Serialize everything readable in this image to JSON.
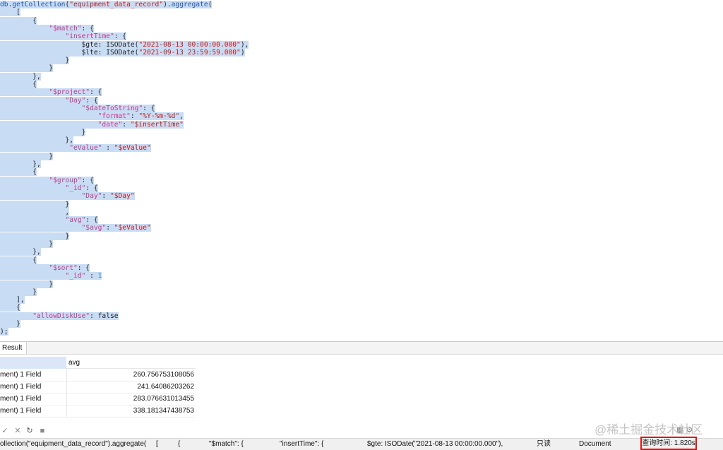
{
  "editor": {
    "lines": [
      [
        [
          "f",
          "db"
        ],
        [
          "p",
          "."
        ],
        [
          "f",
          "getCollection"
        ],
        [
          "p",
          "("
        ],
        [
          "s",
          "\"equipment_data_record\""
        ],
        [
          "p",
          ")."
        ],
        [
          "f",
          "aggregate"
        ],
        [
          "p",
          "("
        ]
      ],
      [
        [
          "p",
          "    ["
        ]
      ],
      [
        [
          "p",
          "        {"
        ]
      ],
      [
        [
          "p",
          "            "
        ],
        [
          "k",
          "\"$match\""
        ],
        [
          "p",
          ": {"
        ]
      ],
      [
        [
          "p",
          "                "
        ],
        [
          "k",
          "\"insertTime\""
        ],
        [
          "p",
          ": {"
        ]
      ],
      [
        [
          "p",
          "                    "
        ],
        [
          "i",
          "$gte"
        ],
        [
          "p",
          ": "
        ],
        [
          "i",
          "ISODate"
        ],
        [
          "p",
          "("
        ],
        [
          "s",
          "\"2021-08-13 00:00:00.000\""
        ],
        [
          "p",
          "),"
        ]
      ],
      [
        [
          "p",
          "                    "
        ],
        [
          "i",
          "$lte"
        ],
        [
          "p",
          ": "
        ],
        [
          "i",
          "ISODate"
        ],
        [
          "p",
          "("
        ],
        [
          "s",
          "\"2021-09-13 23:59:59.000\""
        ],
        [
          "p",
          ")"
        ]
      ],
      [
        [
          "p",
          "                }"
        ]
      ],
      [
        [
          "p",
          "            }"
        ]
      ],
      [
        [
          "p",
          "        },"
        ]
      ],
      [
        [
          "p",
          "        {"
        ]
      ],
      [
        [
          "p",
          "            "
        ],
        [
          "k",
          "\"$project\""
        ],
        [
          "p",
          ": {"
        ]
      ],
      [
        [
          "p",
          "                "
        ],
        [
          "k",
          "\"Day\""
        ],
        [
          "p",
          ": {"
        ]
      ],
      [
        [
          "p",
          "                    "
        ],
        [
          "k",
          "\"$dateToString\""
        ],
        [
          "p",
          ": {"
        ]
      ],
      [
        [
          "p",
          "                        "
        ],
        [
          "k",
          "\"format\""
        ],
        [
          "p",
          ": "
        ],
        [
          "s",
          "\"%Y-%m-%d\""
        ],
        [
          "p",
          ","
        ]
      ],
      [
        [
          "p",
          "                        "
        ],
        [
          "k",
          "\"date\""
        ],
        [
          "p",
          ": "
        ],
        [
          "s",
          "\"$insertTime\""
        ]
      ],
      [
        [
          "p",
          "                    }"
        ]
      ],
      [
        [
          "p",
          "                },"
        ]
      ],
      [
        [
          "p",
          "                 "
        ],
        [
          "k",
          "\"eValue\""
        ],
        [
          "p",
          " : "
        ],
        [
          "s",
          "\"$eValue\""
        ]
      ],
      [
        [
          "p",
          "            }"
        ]
      ],
      [
        [
          "p",
          "        },"
        ]
      ],
      [
        [
          "p",
          "        {"
        ]
      ],
      [
        [
          "p",
          "            "
        ],
        [
          "k",
          "\"$group\""
        ],
        [
          "p",
          ": {"
        ]
      ],
      [
        [
          "p",
          "                "
        ],
        [
          "k",
          "\"_id\""
        ],
        [
          "p",
          ": {"
        ]
      ],
      [
        [
          "p",
          "                    "
        ],
        [
          "k",
          "\"Day\""
        ],
        [
          "p",
          ": "
        ],
        [
          "s",
          "\"$Day\""
        ]
      ],
      [
        [
          "p",
          "                }"
        ]
      ],
      [
        [
          "p",
          "                ,"
        ]
      ],
      [
        [
          "p",
          "                "
        ],
        [
          "k",
          "\"avg\""
        ],
        [
          "p",
          ": {"
        ]
      ],
      [
        [
          "p",
          "                    "
        ],
        [
          "k",
          "\"$avg\""
        ],
        [
          "p",
          ": "
        ],
        [
          "s",
          "\"$eValue\""
        ]
      ],
      [
        [
          "p",
          "                }"
        ]
      ],
      [
        [
          "p",
          "            }"
        ]
      ],
      [
        [
          "p",
          "        },"
        ]
      ],
      [
        [
          "p",
          "        {"
        ]
      ],
      [
        [
          "p",
          "            "
        ],
        [
          "k",
          "\"$sort\""
        ],
        [
          "p",
          ": {"
        ]
      ],
      [
        [
          "p",
          "                "
        ],
        [
          "k",
          "\"_id\""
        ],
        [
          "p",
          " : "
        ],
        [
          "n",
          "1"
        ]
      ],
      [
        [
          "p",
          "            }"
        ]
      ],
      [
        [
          "p",
          "        }"
        ]
      ],
      [
        [
          "p",
          "    ],"
        ]
      ],
      [
        [
          "p",
          "    {"
        ]
      ],
      [
        [
          "p",
          "        "
        ],
        [
          "k",
          "\"allowDiskUse\""
        ],
        [
          "p",
          ": "
        ],
        [
          "i",
          "false"
        ]
      ],
      [
        [
          "p",
          "    }"
        ]
      ],
      [
        [
          "p",
          ");"
        ]
      ]
    ]
  },
  "results": {
    "tab_label": "Result",
    "column_header": "avg",
    "rows": [
      {
        "doc": "ment) 1 Field",
        "avg": "260.756753108056"
      },
      {
        "doc": "ment) 1 Field",
        "avg": "241.64086203262"
      },
      {
        "doc": "ment) 1 Field",
        "avg": "283.076631013455"
      },
      {
        "doc": "ment) 1 Field",
        "avg": "338.181347438753"
      }
    ]
  },
  "toolbar": {
    "icons": [
      "check-icon",
      "close-icon",
      "refresh-icon",
      "stop-icon"
    ]
  },
  "statusbar": {
    "query": "ollection(\"equipment_data_record\").aggregate(",
    "p1": "[",
    "p2": "{",
    "p3": "\"$match\": {",
    "p4": "\"insertTime\": {",
    "p5": "$gte: ISODate(\"2021-08-13 00:00:00.000\"),",
    "mode": "只读",
    "view": "Document",
    "time": "查询时间: 1.820s"
  },
  "watermark": "@稀土掘金技术社区"
}
